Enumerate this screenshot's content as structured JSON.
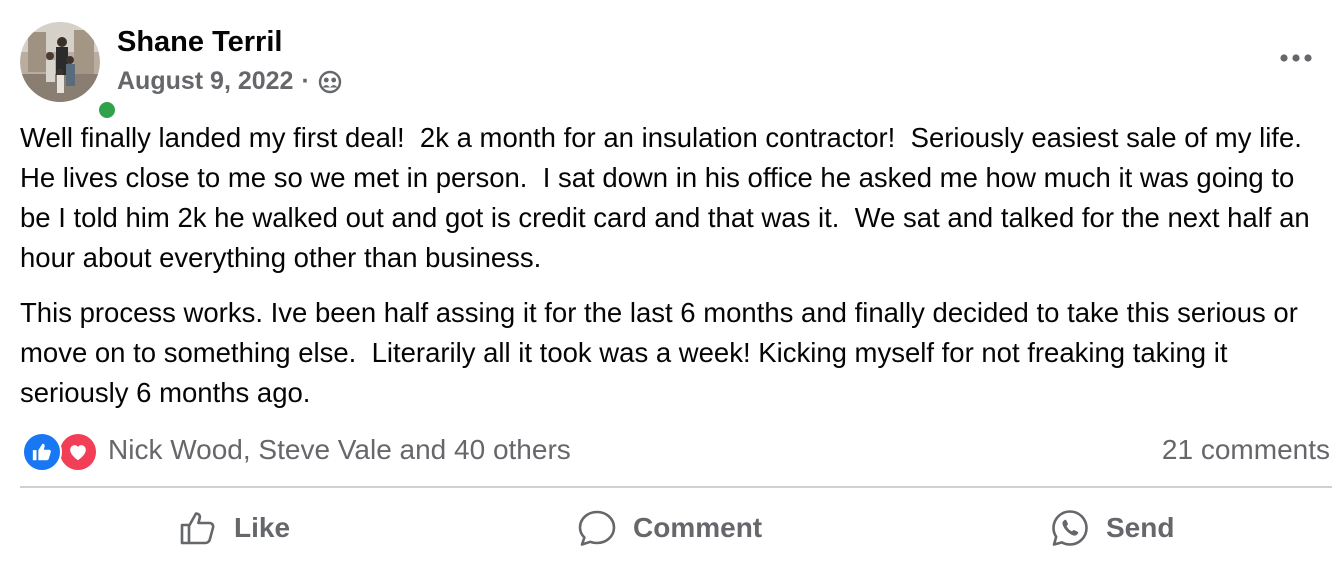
{
  "post": {
    "author": "Shane Terril",
    "date": "August 9, 2022",
    "separator": "·",
    "audience_icon": "friends-icon",
    "paragraphs": [
      "Well finally landed my first deal!  2k a month for an insulation contractor!  Seriously easiest sale of my life.  He lives close to me so we met in person.  I sat down in his office he asked me how much it was going to be I told him 2k he walked out and got is credit card and that was it.  We sat and talked for the next half an hour about everything other than business.",
      "This process works. Ive been half assing it for the last 6 months and finally decided to take this serious or move on to something else.  Literarily all it took was a week! Kicking myself for not freaking taking it seriously 6 months ago."
    ]
  },
  "reactions": {
    "icons": [
      "like-reaction-icon",
      "love-reaction-icon"
    ],
    "summary": "Nick Wood, Steve Vale and 40 others",
    "comments": "21 comments"
  },
  "actions": {
    "like": "Like",
    "comment": "Comment",
    "send": "Send"
  },
  "colors": {
    "secondary_text": "#65676b",
    "online": "#31a24c",
    "like_blue": "#1877f2",
    "love_red": "#f33e58",
    "divider": "#ced0d4"
  }
}
